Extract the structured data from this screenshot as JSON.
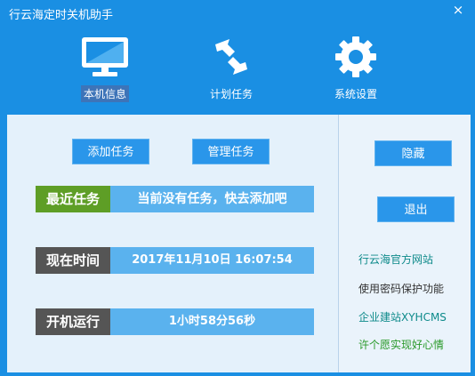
{
  "window": {
    "title": "行云海定时关机助手",
    "close": "×"
  },
  "nav": [
    {
      "label": "本机信息",
      "icon": "monitor-icon"
    },
    {
      "label": "计划任务",
      "icon": "arrows-icon"
    },
    {
      "label": "系统设置",
      "icon": "gear-icon"
    }
  ],
  "buttons": {
    "add_task": "添加任务",
    "manage_task": "管理任务",
    "hide": "隐藏",
    "exit": "退出"
  },
  "rows": {
    "recent": {
      "label": "最近任务",
      "value": "当前没有任务，快去添加吧",
      "label_color": "#5e9e26"
    },
    "now": {
      "label": "现在时间",
      "value": "2017年11月10日  16:07:54",
      "label_color": "#555555"
    },
    "uptime": {
      "label": "开机运行",
      "value": "1小时58分56秒",
      "label_color": "#555555"
    }
  },
  "links": [
    {
      "text": "行云海官方网站",
      "color": "#0d8a8a"
    },
    {
      "text": "使用密码保护功能",
      "color": "#333333"
    },
    {
      "text": "企业建站XYHCMS",
      "color": "#0d8a8a"
    },
    {
      "text": "许个愿实现好心情",
      "color": "#2a9a2a"
    }
  ],
  "colors": {
    "accent": "#1a8fe3",
    "panel": "#e4f1fb",
    "row_value_bg": "#5ab2ee"
  }
}
